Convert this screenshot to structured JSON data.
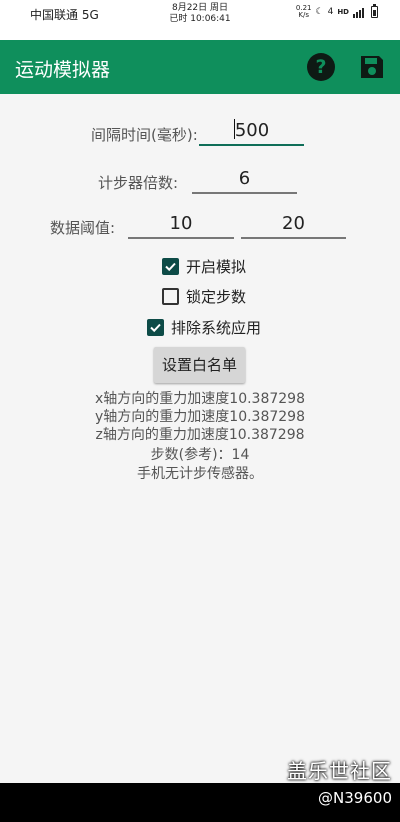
{
  "status_bar": {
    "carrier": "中国联通 5G",
    "date": "8月22日 周日",
    "time": "已时 10:06:41",
    "speed_value": "0.21",
    "speed_unit": "K/s",
    "moon": "☾",
    "signal_num": "4",
    "hd": "HD"
  },
  "app_bar": {
    "title": "运动模拟器",
    "help_icon": "help-circle-icon",
    "save_icon": "save-icon",
    "color": "#0f8f5c"
  },
  "form": {
    "interval_label": "间隔时间(毫秒):",
    "interval_value": "500",
    "multiplier_label": "计步器倍数:",
    "multiplier_value": "6",
    "threshold_label": "数据阈值:",
    "threshold_min": "10",
    "threshold_max": "20"
  },
  "checkboxes": {
    "enable_simulation": {
      "label": "开启模拟",
      "checked": true
    },
    "lock_steps": {
      "label": "锁定步数",
      "checked": false
    },
    "exclude_system_apps": {
      "label": "排除系统应用",
      "checked": true
    }
  },
  "whitelist_button": "设置白名单",
  "info": {
    "x_gravity": "x轴方向的重力加速度10.387298",
    "y_gravity": "y轴方向的重力加速度10.387298",
    "z_gravity": "z轴方向的重力加速度10.387298",
    "steps": "步数(参考)：14",
    "sensor_note": "手机无计步传感器。"
  },
  "watermark": {
    "brand": "盖乐世社区",
    "user": "@N39600"
  }
}
